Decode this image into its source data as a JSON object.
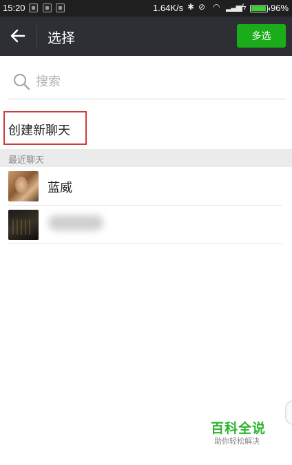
{
  "status_bar": {
    "time": "15:20",
    "notification_icons": [
      "notification-icon",
      "notification-icon",
      "notification-icon"
    ],
    "net_speed": "1.64K/s",
    "icons": [
      "bluetooth-icon",
      "alarm-off-icon",
      "wifi-icon",
      "signal-icon",
      "charging-icon",
      "battery-icon"
    ],
    "battery_percent": "96%",
    "battery_level": 0.96,
    "battery_color": "#3bd134"
  },
  "title_bar": {
    "back_icon": "back-arrow-icon",
    "title": "选择",
    "multi_select_label": "多选",
    "background": "#2e2f34",
    "accent": "#1aad19"
  },
  "search": {
    "icon": "search-icon",
    "placeholder": "搜索",
    "value": ""
  },
  "create_chat": {
    "label": "创建新聊天",
    "highlight_color": "#d23a3a"
  },
  "recent": {
    "header": "最近聊天",
    "contacts": [
      {
        "name": "蓝威",
        "avatar": "avatar"
      },
      {
        "name": "",
        "avatar": "avatar"
      }
    ]
  },
  "watermark": {
    "title": "百科全说",
    "subtitle": "助你轻松解决"
  }
}
